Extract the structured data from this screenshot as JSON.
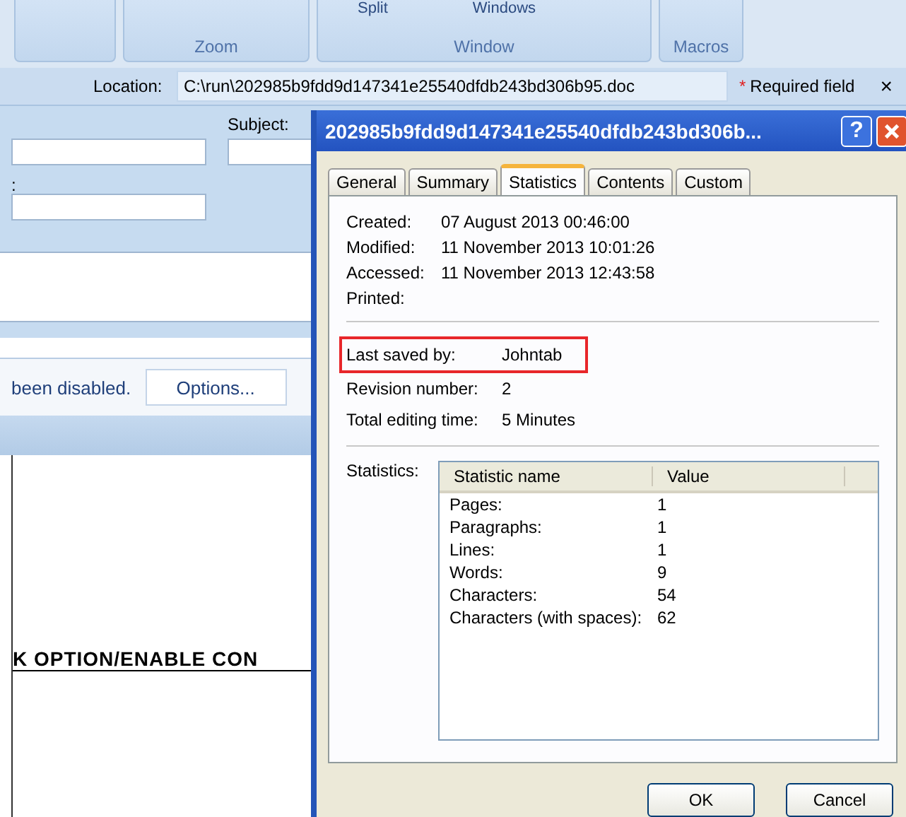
{
  "ribbon": {
    "groups": [
      {
        "label": "Zoom"
      },
      {
        "label": "Window",
        "buttons": [
          "Split",
          "Windows"
        ]
      },
      {
        "label": "Macros"
      }
    ]
  },
  "document_info": {
    "location_label": "Location:",
    "location_value": "C:\\run\\202985b9fdd9d147341e25540dfdb243bd306b95.doc",
    "required_mark": "*",
    "required_note": "Required field",
    "close": "×",
    "subject_label": "Subject:",
    "field_label": ":"
  },
  "message_bar": {
    "text": "been disabled.",
    "button": "Options..."
  },
  "document": {
    "heading": "K OPTION/ENABLE CON"
  },
  "dialog": {
    "title": "202985b9fdd9d147341e25540dfdb243bd306b...",
    "help": "?",
    "tabs": [
      {
        "label": "General",
        "selected": false
      },
      {
        "label": "Summary",
        "selected": false
      },
      {
        "label": "Statistics",
        "selected": true
      },
      {
        "label": "Contents",
        "selected": false
      },
      {
        "label": "Custom",
        "selected": false
      }
    ],
    "dates": [
      {
        "label": "Created:",
        "value": "07 August 2013 00:46:00"
      },
      {
        "label": "Modified:",
        "value": "11 November 2013 10:01:26"
      },
      {
        "label": "Accessed:",
        "value": "11 November 2013 12:43:58"
      },
      {
        "label": "Printed:"
      }
    ],
    "saved": [
      {
        "label": "Last saved by:",
        "value": "Johntab",
        "highlighted": true
      },
      {
        "label": "Revision number:",
        "value": "2",
        "highlighted": false
      },
      {
        "label": "Total editing time:",
        "value": "5 Minutes",
        "highlighted": false
      }
    ],
    "statistics_label": "Statistics:",
    "table": {
      "columns": [
        "Statistic name",
        "Value"
      ],
      "rows": [
        [
          "Pages:",
          "1"
        ],
        [
          "Paragraphs:",
          "1"
        ],
        [
          "Lines:",
          "1"
        ],
        [
          "Words:",
          "9"
        ],
        [
          "Characters:",
          "54"
        ],
        [
          "Characters (with spaces):",
          "62"
        ]
      ]
    },
    "buttons": [
      "OK",
      "Cancel"
    ]
  }
}
